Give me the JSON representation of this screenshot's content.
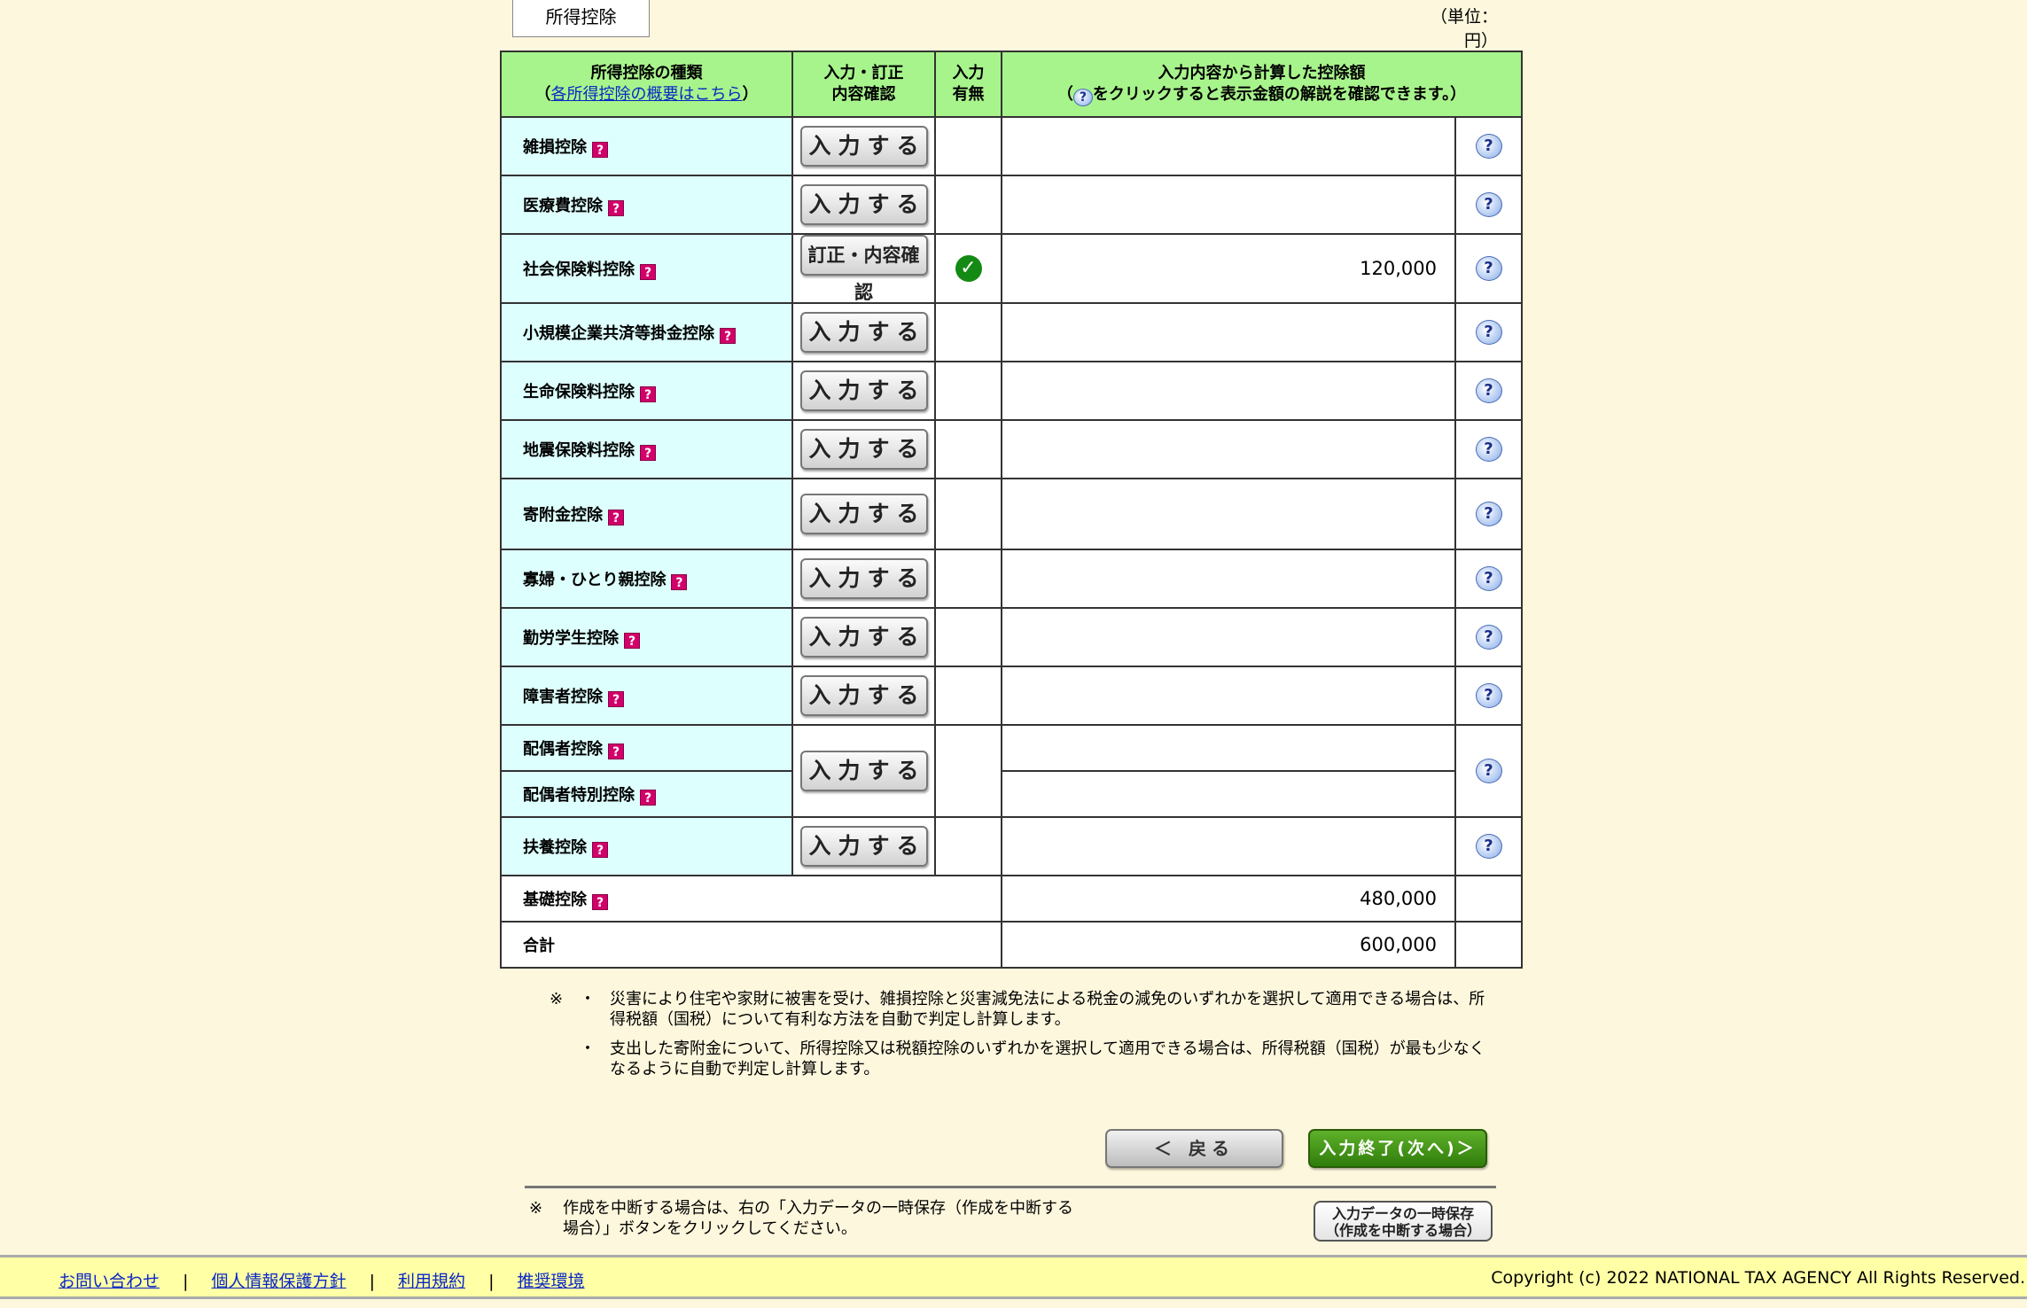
{
  "tab_label": "所得控除",
  "unit_label": "（単位：円）",
  "header": {
    "col1_line1": "所得控除の種類",
    "col1_link": "各所得控除の概要はこちら",
    "col2_line1": "入力・訂正",
    "col2_line2": "内容確認",
    "col3_line1": "入力",
    "col3_line2": "有無",
    "col4_line1": "入力内容から計算した控除額",
    "col4_line2": "をクリックすると表示金額の解説を確認できます。）"
  },
  "rows": [
    {
      "label": "雑損控除",
      "button": "入力する",
      "amount": ""
    },
    {
      "label": "医療費控除",
      "button": "入力する",
      "amount": ""
    },
    {
      "label": "社会保険料控除",
      "button": "訂正・内容確認",
      "amount": "120,000"
    },
    {
      "label": "小規模企業共済等掛金控除",
      "button": "入力する",
      "amount": ""
    },
    {
      "label": "生命保険料控除",
      "button": "入力する",
      "amount": ""
    },
    {
      "label": "地震保険料控除",
      "button": "入力する",
      "amount": ""
    },
    {
      "label": "寄附金控除",
      "button": "入力する",
      "amount": ""
    },
    {
      "label": "寡婦・ひとり親控除",
      "button": "入力する",
      "amount": ""
    },
    {
      "label": "勤労学生控除",
      "button": "入力する",
      "amount": ""
    },
    {
      "label": "障害者控除",
      "button": "入力する",
      "amount": ""
    },
    {
      "label": "配偶者控除",
      "label2": "配偶者特別控除",
      "button": "入力する",
      "amount": ""
    },
    {
      "label": "扶養控除",
      "button": "入力する",
      "amount": ""
    }
  ],
  "basic": {
    "label": "基礎控除",
    "amount": "480,000"
  },
  "total": {
    "label": "合計",
    "amount": "600,000"
  },
  "notes": {
    "mark": "※",
    "bullet": "・",
    "note1": "災害により住宅や家財に被害を受け、雑損控除と災害減免法による税金の減免のいずれかを選択して適用できる場合は、所得税額（国税）について有利な方法を自動で判定し計算します。",
    "note2": "支出した寄附金について、所得控除又は税額控除のいずれかを選択して適用できる場合は、所得税額（国税）が最も少なくなるように自動で判定し計算します。"
  },
  "buttons": {
    "back": "＜ 戻る",
    "next": "入力終了(次へ)＞",
    "save_line1": "入力データの一時保存",
    "save_line2": "（作成を中断する場合）"
  },
  "save_note": {
    "mark": "※",
    "text": "作成を中断する場合は、右の「入力データの一時保存（作成を中断する場合）」ボタンをクリックしてください。"
  },
  "footer": {
    "links": [
      "お問い合わせ",
      "個人情報保護方針",
      "利用規約",
      "推奨環境"
    ],
    "separator": "|",
    "copyright": "Copyright (c) 2022 NATIONAL TAX AGENCY All Rights Reserved."
  }
}
